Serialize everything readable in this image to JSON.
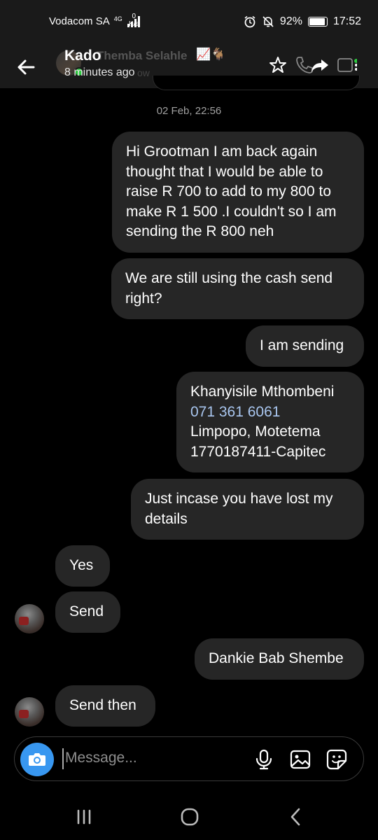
{
  "status_bar": {
    "carrier": "Vodacom SA",
    "signal_type": "4G",
    "net_speed_value": "0",
    "net_speed_unit": "K/s",
    "battery": "92%",
    "battery_level": 0.92,
    "time": "17:52"
  },
  "header": {
    "contact_name": "Kado",
    "ghost_name": "Themba Selahle",
    "ghost_emoji": "📈🐐",
    "last_seen": "8 minutes ago",
    "ghost_active": "ow"
  },
  "conversation": {
    "date_separator": "02 Feb, 22:56",
    "messages": [
      {
        "direction": "sent",
        "text": "Hi Grootman I am back again thought that I would be able to raise R 700 to add to my 800 to make R 1 500 .I couldn't so I am sending the R 800 neh"
      },
      {
        "direction": "sent",
        "text": "We are still using the cash send right?"
      },
      {
        "direction": "sent",
        "text": "I am sending"
      },
      {
        "direction": "sent",
        "lines": [
          "Khanyisile Mthombeni",
          "071 361 6061",
          "Limpopo, Motetema",
          "1770187411-Capitec"
        ]
      },
      {
        "direction": "sent",
        "text": "Just incase you have lost my details"
      },
      {
        "direction": "received",
        "text": "Yes"
      },
      {
        "direction": "received",
        "text": "Send",
        "avatar": true
      },
      {
        "direction": "sent",
        "text": "Dankie Bab Shembe"
      },
      {
        "direction": "received",
        "text": "Send then",
        "avatar": true
      }
    ]
  },
  "composer": {
    "placeholder": "Message..."
  },
  "icons": {
    "back": "arrow-left-icon",
    "star": "star-icon",
    "phone": "phone-icon",
    "share": "share-arrow-icon",
    "video": "video-call-icon",
    "camera": "camera-icon",
    "mic": "microphone-icon",
    "gallery": "gallery-icon",
    "sticker": "sticker-icon",
    "nav_recents": "recents-icon",
    "nav_home": "home-icon",
    "nav_back": "back-chevron-icon"
  },
  "colors": {
    "background": "#000000",
    "bubble": "#262626",
    "accent_camera": "#3897f0",
    "phone_link": "#a9c6ef",
    "online": "#2ecc40"
  }
}
